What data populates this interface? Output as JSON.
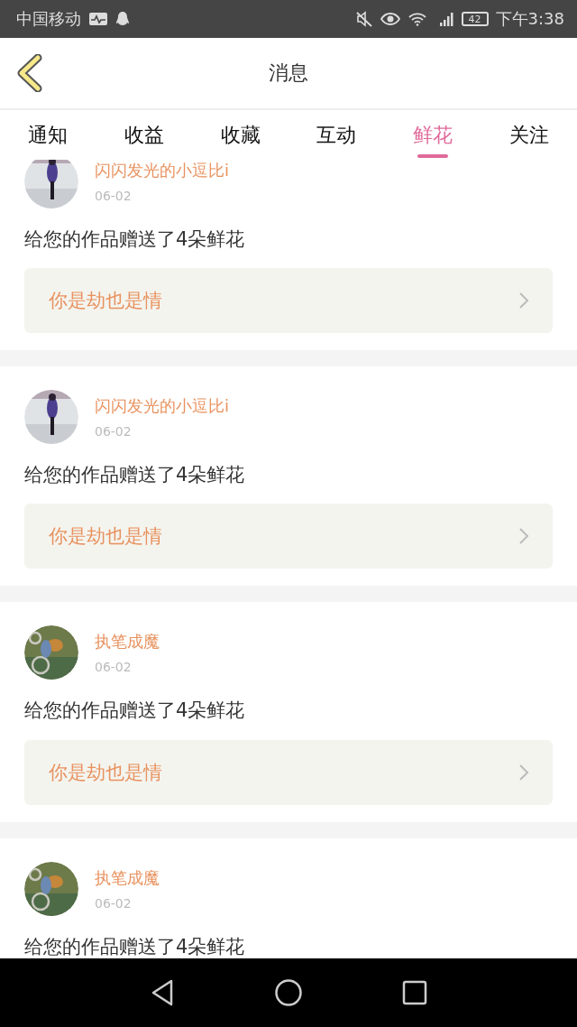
{
  "status_bar": {
    "carrier": "中国移动",
    "battery": "42",
    "time": "下午3:38"
  },
  "header": {
    "title": "消息"
  },
  "tabs": [
    {
      "label": "通知",
      "selected": false
    },
    {
      "label": "收益",
      "selected": false
    },
    {
      "label": "收藏",
      "selected": false
    },
    {
      "label": "互动",
      "selected": false
    },
    {
      "label": "鲜花",
      "selected": true
    },
    {
      "label": "关注",
      "selected": false
    }
  ],
  "notifications": [
    {
      "user": "闪闪发光的小逗比i",
      "date": "06-02",
      "message": "给您的作品赠送了4朵鲜花",
      "work": "你是劫也是情"
    },
    {
      "user": "闪闪发光的小逗比i",
      "date": "06-02",
      "message": "给您的作品赠送了4朵鲜花",
      "work": "你是劫也是情"
    },
    {
      "user": "执笔成魔",
      "date": "06-02",
      "message": "给您的作品赠送了4朵鲜花",
      "work": "你是劫也是情"
    },
    {
      "user": "执笔成魔",
      "date": "06-02",
      "message": "给您的作品赠送了4朵鲜花"
    }
  ]
}
